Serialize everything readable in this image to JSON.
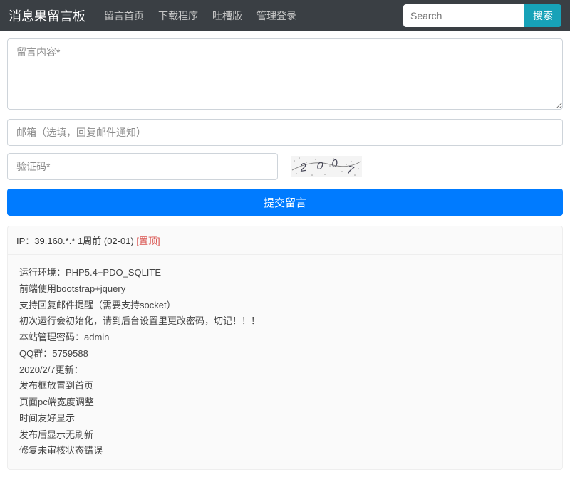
{
  "navbar": {
    "brand": "消息果留言板",
    "links": [
      "留言首页",
      "下载程序",
      "吐槽版",
      "管理登录"
    ],
    "search_placeholder": "Search",
    "search_btn": "搜索"
  },
  "form": {
    "content_placeholder": "留言内容*",
    "email_placeholder": "邮箱（选填，回复邮件通知）",
    "captcha_placeholder": "验证码*",
    "captcha_value": "2007",
    "submit_label": "提交留言"
  },
  "post": {
    "header_ip_prefix": "IP：",
    "header_ip": "39.160.*.*",
    "header_time": "1周前 (02-01)",
    "pin_label": "[置顶]",
    "lines": [
      "运行环境：PHP5.4+PDO_SQLITE",
      "前端使用bootstrap+jquery",
      "支持回复邮件提醒（需要支持socket）",
      "初次运行会初始化，请到后台设置里更改密码，切记！！！",
      "本站管理密码：admin",
      "QQ群：5759588",
      "2020/2/7更新：",
      "发布框放置到首页",
      "页面pc端宽度调整",
      "时间友好显示",
      "发布后显示无刷新",
      "修复未审核状态错误"
    ]
  }
}
